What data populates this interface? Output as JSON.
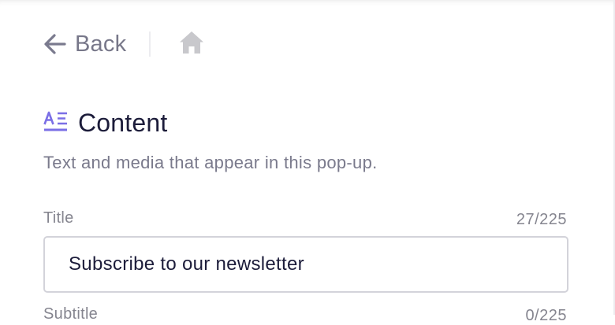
{
  "nav": {
    "back_label": "Back",
    "back_icon": "arrow-left-icon",
    "home_icon": "home-icon"
  },
  "section": {
    "icon": "text-content-icon",
    "title": "Content",
    "description": "Text and media that appear in this pop-up."
  },
  "fields": {
    "title": {
      "label": "Title",
      "count": "27/225",
      "value": "Subscribe to our newsletter"
    },
    "subtitle": {
      "label": "Subtitle",
      "count": "0/225"
    }
  },
  "colors": {
    "accent": "#7b6fe6",
    "text_primary": "#1c1c3a",
    "text_muted": "#7a7a8c",
    "border": "#d3d3da",
    "home_icon": "#c8c8cc"
  }
}
